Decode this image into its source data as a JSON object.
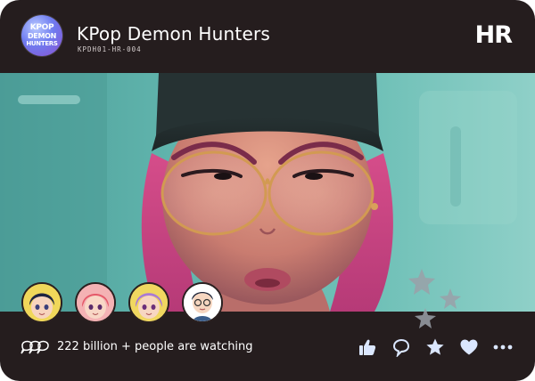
{
  "card": {
    "logo": {
      "line1": "KPOP",
      "line2": "DEMON",
      "line3": "HUNTERS",
      "icon": "kpop-demon-hunters-logo"
    },
    "title": "KPop Demon Hunters",
    "code": "KPDH01-HR-004",
    "rank": "HR"
  },
  "scene": {
    "description_icon": "character-portrait"
  },
  "avatars": [
    {
      "icon": "avatar-dark-hair-girl"
    },
    {
      "icon": "avatar-pink-hair-girl"
    },
    {
      "icon": "avatar-purple-hair-girl"
    },
    {
      "icon": "avatar-glasses-man"
    }
  ],
  "footer": {
    "viewers_icon": "speech-bubbles-icon",
    "viewers_text": "222 billion + people are watching",
    "actions": [
      {
        "icon": "thumbs-up-icon"
      },
      {
        "icon": "comment-icon"
      },
      {
        "icon": "star-icon"
      },
      {
        "icon": "heart-icon"
      },
      {
        "icon": "more-icon"
      }
    ]
  },
  "colors": {
    "card_bg": "#251d1e",
    "text": "#ffffff",
    "accent_blue": "#dbe7ff",
    "scene_teal": "#5fb3ad"
  }
}
